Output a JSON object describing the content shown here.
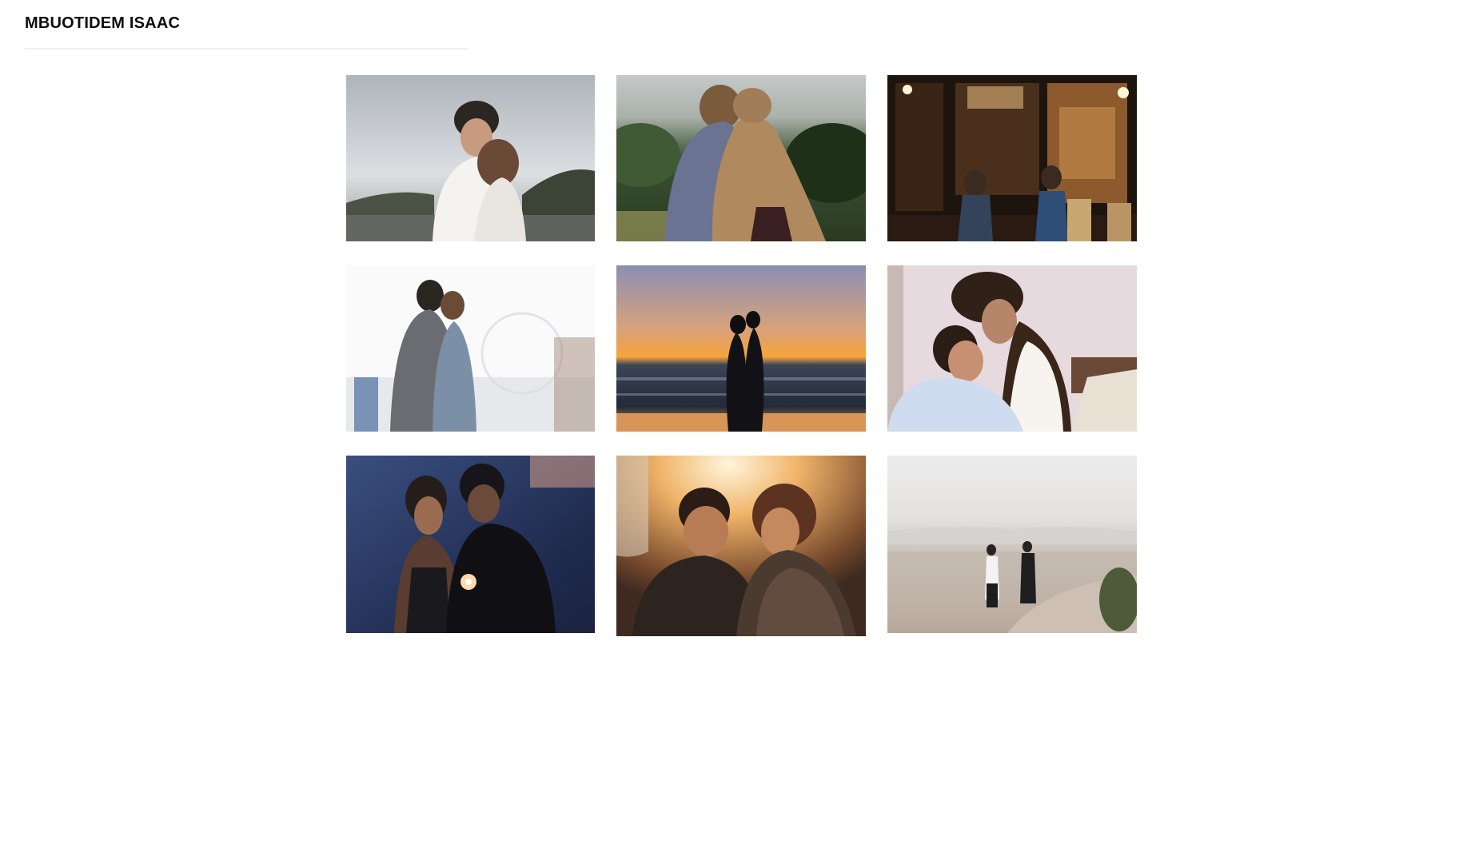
{
  "header": {
    "title": "MBUOTIDEM ISAAC"
  },
  "gallery": {
    "photos": [
      {
        "subject": "couple-embracing-overcast-sky",
        "palette": [
          "#c9ccd0",
          "#f2f2f2",
          "#3a3a38"
        ]
      },
      {
        "subject": "couple-from-behind-hillside",
        "palette": [
          "#c7c9c9",
          "#2f4a2a",
          "#a88257"
        ]
      },
      {
        "subject": "couple-in-restaurant-at-night",
        "palette": [
          "#2a1c14",
          "#a36a33",
          "#e5b46c"
        ]
      },
      {
        "subject": "couple-foreheads-touching-fairground",
        "palette": [
          "#f8f6f8",
          "#5d5f66",
          "#8b97a8"
        ]
      },
      {
        "subject": "couple-silhouette-kissing-sunset-beach",
        "palette": [
          "#8c8fb2",
          "#f2a13f",
          "#202633"
        ]
      },
      {
        "subject": "couple-laughing-on-sofa",
        "palette": [
          "#e7dcdf",
          "#f5f2ee",
          "#5a3b2c"
        ]
      },
      {
        "subject": "couple-with-sparkler-dusk",
        "palette": [
          "#2c3d6c",
          "#1a1c29",
          "#d99a66"
        ]
      },
      {
        "subject": "couple-smiling-golden-light",
        "palette": [
          "#f3c07c",
          "#3b2a22",
          "#8a5a3a"
        ]
      },
      {
        "subject": "couple-overlooking-city-cliff",
        "palette": [
          "#ececec",
          "#c9c3bd",
          "#232323"
        ]
      }
    ]
  }
}
